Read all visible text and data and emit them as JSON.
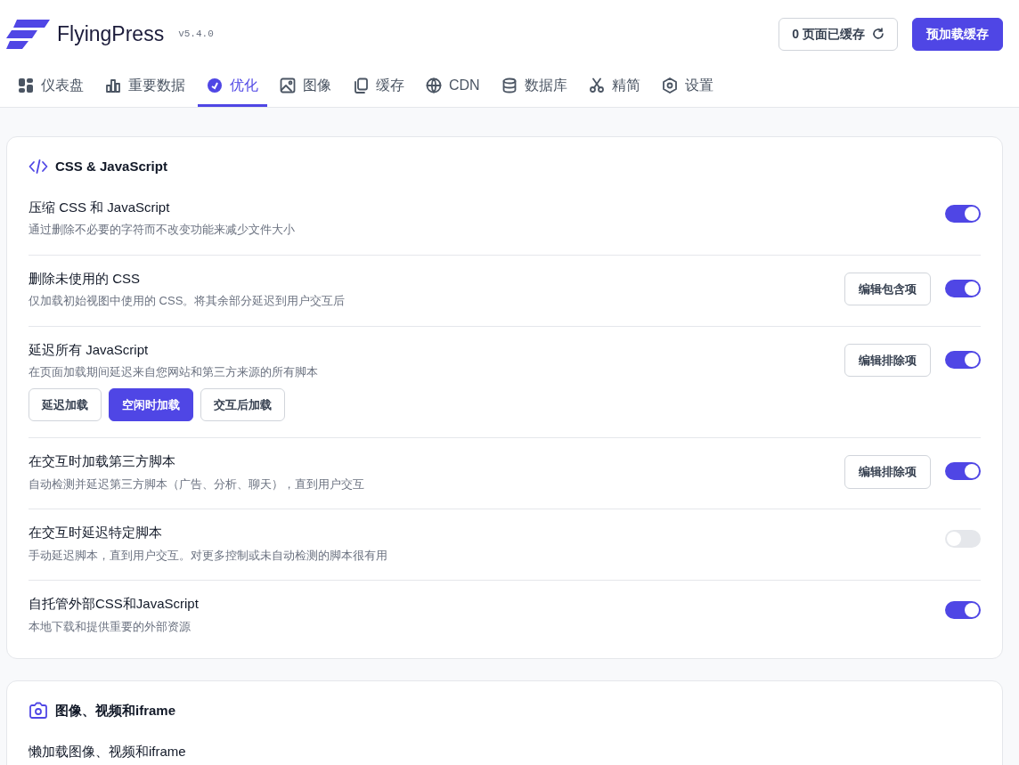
{
  "header": {
    "brand": "FlyingPress",
    "version": "v5.4.0",
    "cache_button": "0 页面已缓存",
    "preload_button": "预加载缓存"
  },
  "tabs": [
    {
      "label": "仪表盘",
      "kind": "grid",
      "selected": false
    },
    {
      "label": "重要数据",
      "kind": "bars",
      "selected": false
    },
    {
      "label": "优化",
      "kind": "gauge",
      "selected": true
    },
    {
      "label": "图像",
      "kind": "image",
      "selected": false
    },
    {
      "label": "缓存",
      "kind": "copy",
      "selected": false
    },
    {
      "label": "CDN",
      "kind": "globe",
      "selected": false
    },
    {
      "label": "数据库",
      "kind": "database",
      "selected": false
    },
    {
      "label": "精简",
      "kind": "scissors",
      "selected": false
    },
    {
      "label": "设置",
      "kind": "hexagon",
      "selected": false
    }
  ],
  "sections": [
    {
      "title": "CSS & JavaScript",
      "kind": "code",
      "settings": [
        {
          "title": "压缩 CSS 和 JavaScript",
          "description": "通过删除不必要的字符而不改变功能来减少文件大小",
          "on": true
        },
        {
          "title": "删除未使用的 CSS",
          "description": "仅加载初始视图中使用的 CSS。将其余部分延迟到用户交互后",
          "button": "编辑包含项",
          "on": true
        },
        {
          "title": "延迟所有 JavaScript",
          "description": "在页面加载期间延迟来自您网站和第三方来源的所有脚本",
          "button": "编辑排除项",
          "on": true,
          "options": [
            {
              "label": "延迟加载",
              "selected": false
            },
            {
              "label": "空闲时加载",
              "selected": true
            },
            {
              "label": "交互后加载",
              "selected": false
            }
          ]
        },
        {
          "title": "在交互时加载第三方脚本",
          "description": "自动检测并延迟第三方脚本（广告、分析、聊天），直到用户交互",
          "button": "编辑排除项",
          "on": true
        },
        {
          "title": "在交互时延迟特定脚本",
          "description": "手动延迟脚本，直到用户交互。对更多控制或未自动检测的脚本很有用",
          "on": false
        },
        {
          "title": "自托管外部CSS和JavaScript",
          "description": "本地下载和提供重要的外部资源",
          "on": true
        }
      ]
    },
    {
      "title": "图像、视频和iframe",
      "kind": "camera",
      "settings": [
        {
          "title": "懒加载图像、视频和iframe"
        }
      ]
    }
  ]
}
